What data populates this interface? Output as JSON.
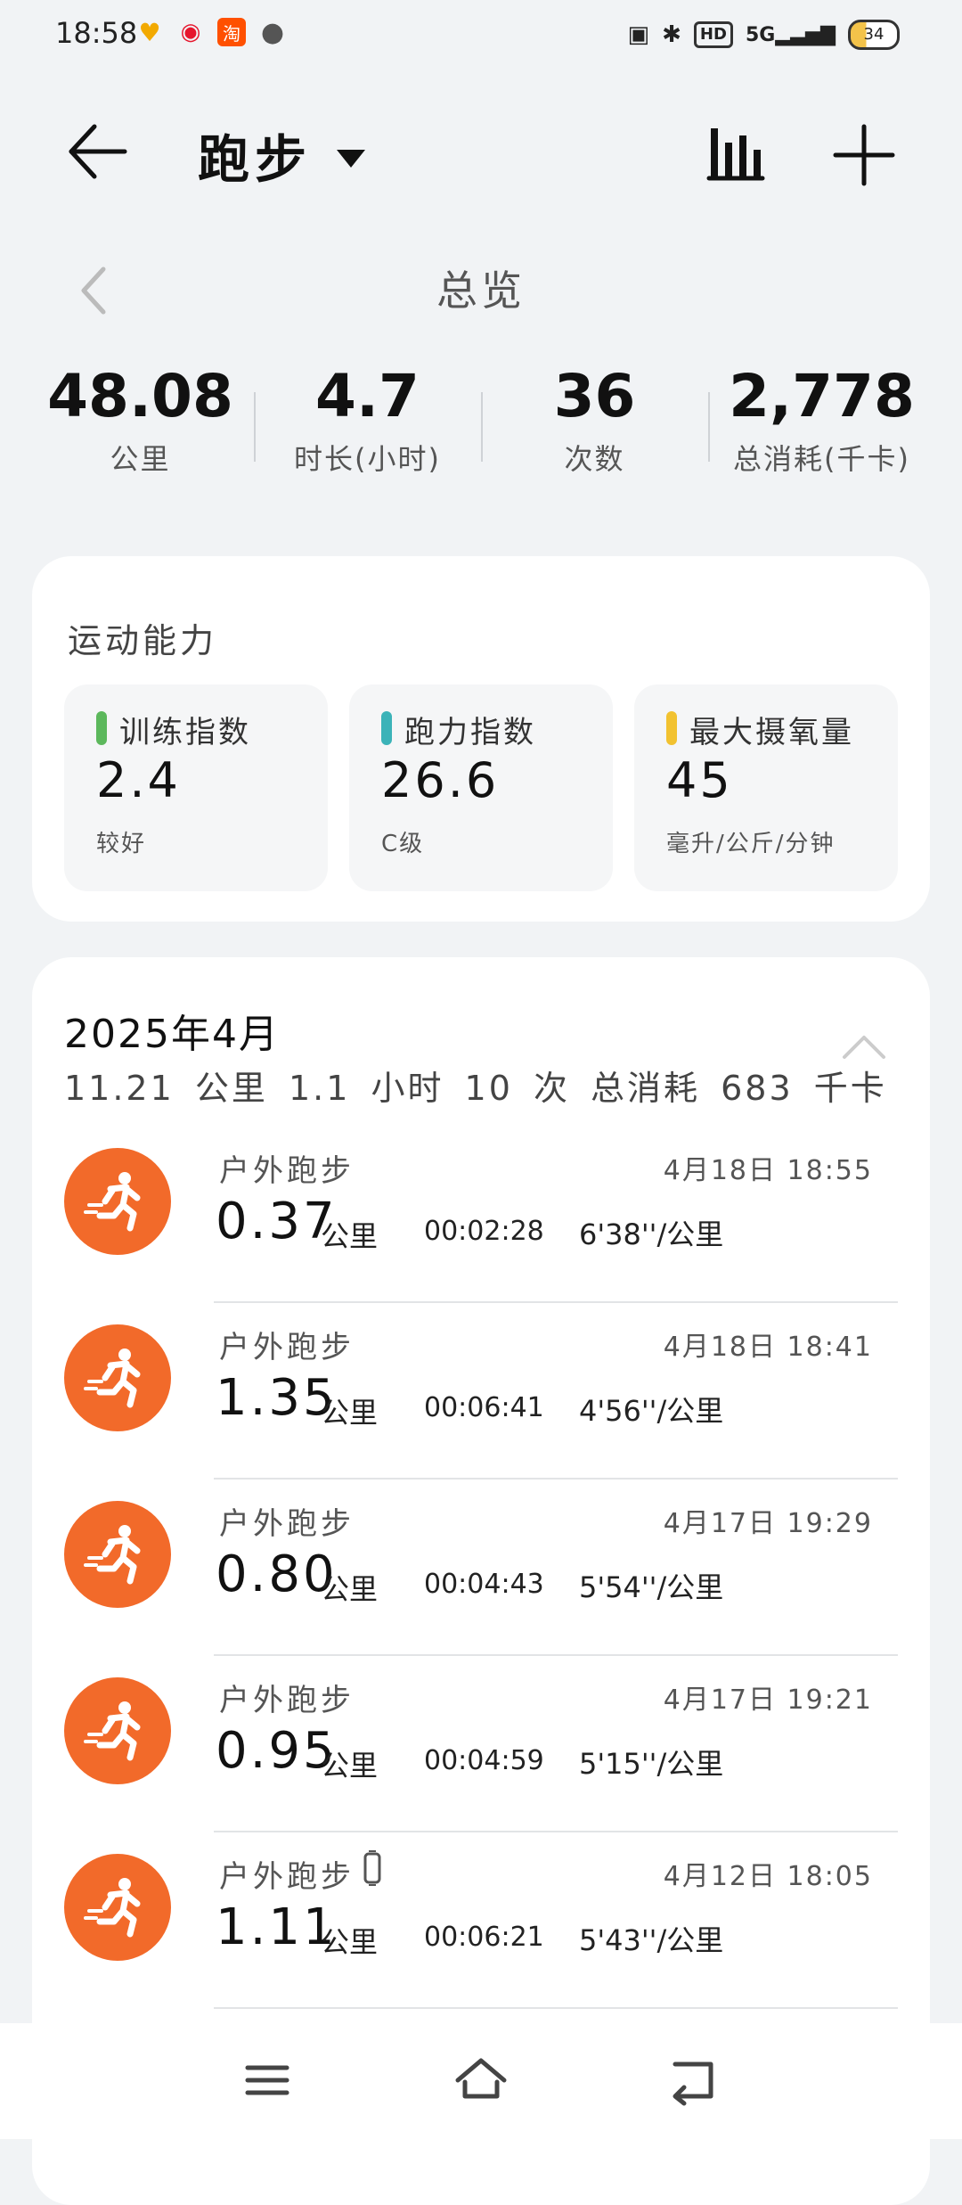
{
  "status_bar": {
    "time": "18:58",
    "left_icons": [
      "huawei-health-icon",
      "weibo-icon",
      "taobao-icon",
      "message-icon"
    ],
    "right_icons": [
      "contact-icon",
      "bluetooth-icon",
      "hd-icon",
      "5g-signal-icon"
    ],
    "hd_label": "HD",
    "net_label": "5G",
    "battery": "34"
  },
  "header": {
    "title": "跑步",
    "back_icon": "arrow-left-icon",
    "stats_icon": "bar-chart-icon",
    "add_icon": "plus-icon"
  },
  "overview": {
    "title": "总览",
    "summary": [
      {
        "value": "48.08",
        "label": "公里"
      },
      {
        "value": "4.7",
        "label": "时长(小时)"
      },
      {
        "value": "36",
        "label": "次数"
      },
      {
        "value": "2,778",
        "label": "总消耗(千卡)"
      }
    ]
  },
  "ability": {
    "title": "运动能力",
    "items": [
      {
        "label": "训练指数",
        "value": "2.4",
        "sub": "较好",
        "color": "#5cb85c"
      },
      {
        "label": "跑力指数",
        "value": "26.6",
        "sub": "C级",
        "color": "#3bb3b8"
      },
      {
        "label": "最大摄氧量",
        "value": "45",
        "sub": "毫升/公斤/分钟",
        "color": "#f2c230"
      }
    ]
  },
  "month": {
    "title": "2025年4月",
    "summary": "11.21 公里  1.1 小时  10 次  总消耗 683 千卡",
    "records": [
      {
        "type": "户外跑步",
        "date": "4月18日 18:55",
        "distance": "0.37",
        "unit": "公里",
        "duration": "00:02:28",
        "pace": "6'38''/公里"
      },
      {
        "type": "户外跑步",
        "date": "4月18日 18:41",
        "distance": "1.35",
        "unit": "公里",
        "duration": "00:06:41",
        "pace": "4'56''/公里"
      },
      {
        "type": "户外跑步",
        "date": "4月17日 19:29",
        "distance": "0.80",
        "unit": "公里",
        "duration": "00:04:43",
        "pace": "5'54''/公里"
      },
      {
        "type": "户外跑步",
        "date": "4月17日 19:21",
        "distance": "0.95",
        "unit": "公里",
        "duration": "00:04:59",
        "pace": "5'15''/公里"
      },
      {
        "type": "户外跑步",
        "date": "4月12日 18:05",
        "distance": "1.11",
        "unit": "公里",
        "duration": "00:06:21",
        "pace": "5'43''/公里",
        "device_icon": "watch-icon"
      }
    ]
  },
  "colors": {
    "accent": "#f26a2a",
    "background": "#f1f3f5"
  }
}
